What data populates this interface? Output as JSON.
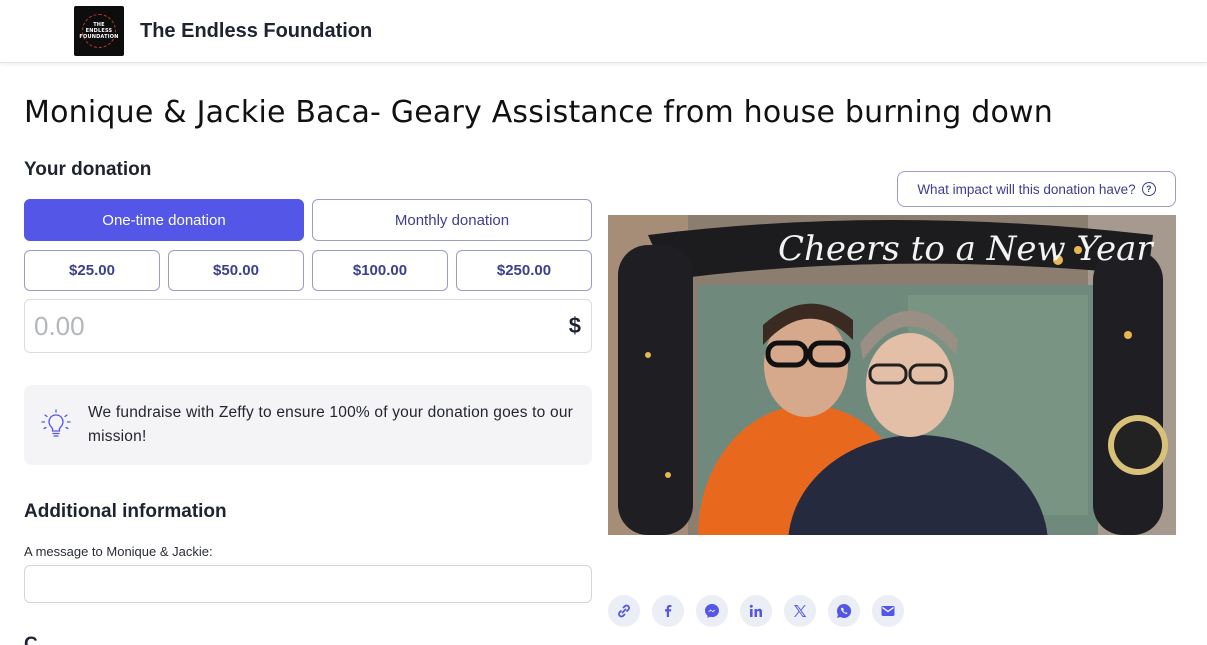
{
  "header": {
    "org_name": "The Endless Foundation",
    "logo_lines": [
      "THE",
      "ENDLESS",
      "FOUNDATION"
    ]
  },
  "page": {
    "title": "Monique & Jackie Baca- Geary Assistance from house burning down"
  },
  "donation": {
    "section_title": "Your donation",
    "frequency": {
      "one_time_label": "One-time donation",
      "monthly_label": "Monthly donation",
      "selected": "One-time donation"
    },
    "amounts": [
      "$25.00",
      "$50.00",
      "$100.00",
      "$250.00"
    ],
    "custom_amount_placeholder": "0.00",
    "currency_symbol": "$",
    "info_text": "We fundraise with Zeffy to ensure 100% of your donation goes to our mission!"
  },
  "additional": {
    "section_title": "Additional information",
    "message_label": "A message to Monique & Jackie:",
    "message_value": "",
    "next_section_partial": "C"
  },
  "impact": {
    "button_label": "What impact will this donation have?"
  },
  "share": {
    "icons": [
      "link-icon",
      "facebook-icon",
      "messenger-icon",
      "linkedin-icon",
      "x-icon",
      "whatsapp-icon",
      "email-icon"
    ]
  },
  "colors": {
    "accent": "#5356e6",
    "accent_text": "#3b3f8f",
    "info_bg": "#f4f4f7"
  }
}
